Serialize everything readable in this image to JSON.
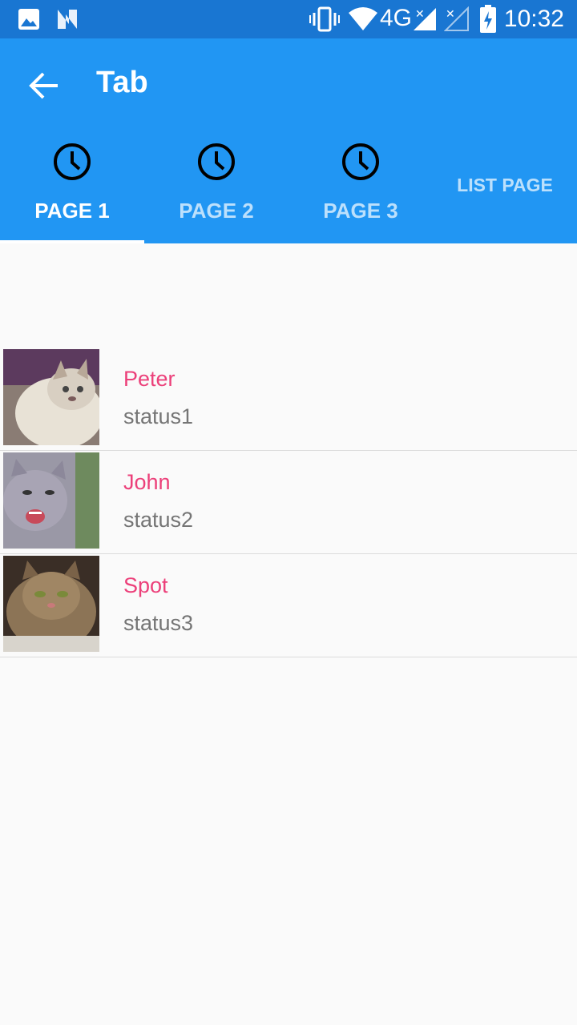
{
  "status_bar": {
    "time": "10:32",
    "network": "4G",
    "icons": [
      "image-icon",
      "n-icon",
      "vibrate-icon",
      "wifi-icon",
      "signal-icon",
      "signal-x-icon",
      "battery-charging-icon"
    ]
  },
  "app_bar": {
    "title": "Tab",
    "back_icon": "arrow-back-icon",
    "color": "#2196f3"
  },
  "tabs": [
    {
      "label": "PAGE 1",
      "icon": "clock-icon",
      "selected": true
    },
    {
      "label": "PAGE 2",
      "icon": "clock-icon",
      "selected": false
    },
    {
      "label": "PAGE 3",
      "icon": "clock-icon",
      "selected": false
    },
    {
      "label": "LIST PAGE",
      "selected": false
    }
  ],
  "list": [
    {
      "name": "Peter",
      "status": "status1",
      "avatar": "cat-photo-1"
    },
    {
      "name": "John",
      "status": "status2",
      "avatar": "cat-photo-2"
    },
    {
      "name": "Spot",
      "status": "status3",
      "avatar": "cat-photo-3"
    }
  ],
  "colors": {
    "status_bar": "#1976d2",
    "accent_name": "#ec407a",
    "secondary_text": "#757575"
  }
}
